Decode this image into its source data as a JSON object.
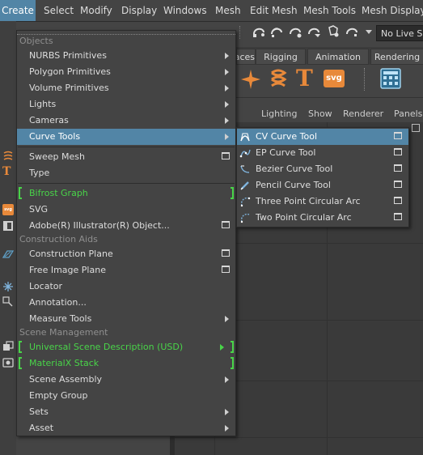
{
  "menubar": {
    "items": [
      "Create",
      "Select",
      "Modify",
      "Display",
      "Windows",
      "Mesh",
      "Edit Mesh",
      "Mesh Tools",
      "Mesh Display"
    ]
  },
  "toolbar": {
    "live_field": "No Live Surface",
    "icons": [
      "snap-grid-icon",
      "snap-curve-icon",
      "snap-point-icon",
      "snap-view-plane-icon",
      "snap-live-icon",
      "snap-dropdown-icon"
    ]
  },
  "shelf": {
    "tabs": [
      "Curves / Surfaces",
      "Rigging",
      "Animation",
      "Rendering"
    ],
    "icons": [
      "sweep-star-icon",
      "sweep-mesh-shelf-icon",
      "type-shelf-icon",
      "svg-shelf-icon",
      "layout-shelf-icon"
    ],
    "svg_label": "svg"
  },
  "panel_menus": [
    "Lighting",
    "Show",
    "Renderer",
    "Panels"
  ],
  "create_menu": {
    "sections": {
      "objects": "Objects",
      "construction_aids": "Construction Aids",
      "scene_management": "Scene Management"
    },
    "items": [
      {
        "label": "NURBS Primitives"
      },
      {
        "label": "Polygon Primitives"
      },
      {
        "label": "Volume Primitives"
      },
      {
        "label": "Lights"
      },
      {
        "label": "Cameras"
      },
      {
        "label": "Curve Tools"
      },
      {
        "label": "Sweep Mesh"
      },
      {
        "label": "Type"
      },
      {
        "label": "Bifrost Graph"
      },
      {
        "label": "SVG"
      },
      {
        "label": "Adobe(R) Illustrator(R) Object..."
      },
      {
        "label": "Construction Plane"
      },
      {
        "label": "Free Image Plane"
      },
      {
        "label": "Locator"
      },
      {
        "label": "Annotation..."
      },
      {
        "label": "Measure Tools"
      },
      {
        "label": "Universal Scene Description (USD)"
      },
      {
        "label": "MaterialX Stack"
      },
      {
        "label": "Scene Assembly"
      },
      {
        "label": "Empty Group"
      },
      {
        "label": "Sets"
      },
      {
        "label": "Asset"
      }
    ]
  },
  "curve_tools_menu": {
    "items": [
      {
        "label": "CV Curve Tool"
      },
      {
        "label": "EP Curve Tool"
      },
      {
        "label": "Bezier Curve Tool"
      },
      {
        "label": "Pencil Curve Tool"
      },
      {
        "label": "Three Point Circular Arc"
      },
      {
        "label": "Two Point Circular Arc"
      }
    ]
  },
  "colors": {
    "highlight": "#5285a6",
    "menu_bg": "#444444",
    "green": "#49d449",
    "accent_orange": "#e8893a"
  }
}
